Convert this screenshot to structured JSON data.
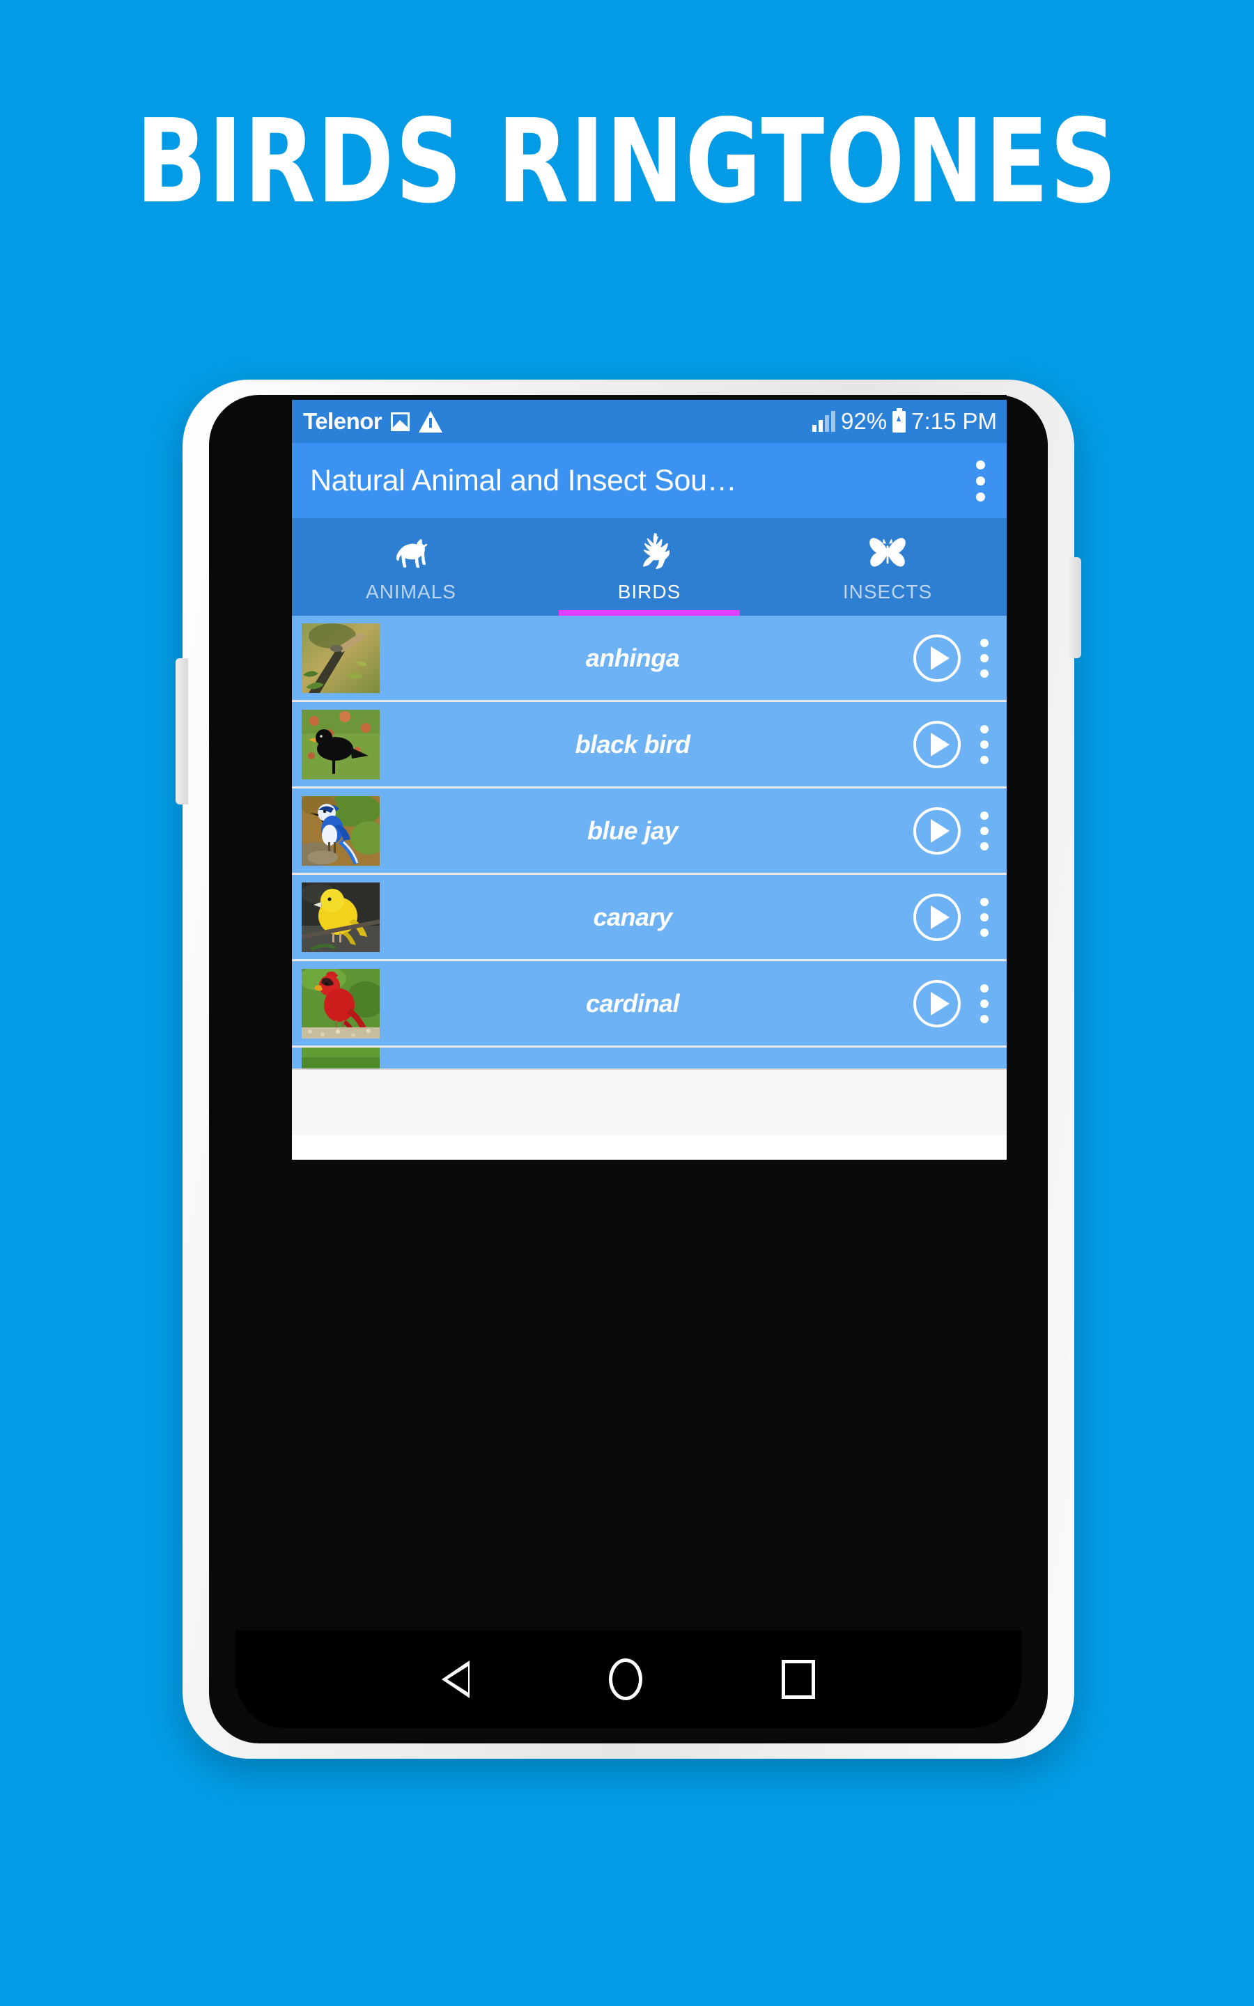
{
  "poster": {
    "title": "BIRDS RINGTONES",
    "background_color": "#039BE5"
  },
  "phone": {
    "case_color": "#F2F2F2",
    "body_color": "#090909"
  },
  "status_bar": {
    "carrier": "Telenor",
    "icons": [
      "image-icon",
      "warning-icon"
    ],
    "signal_icon": "signal-bars-icon",
    "battery_percent": "92%",
    "battery_icon": "battery-charging-icon",
    "time": "7:15 PM",
    "background_color": "#2B80D8"
  },
  "app_bar": {
    "title": "Natural Animal and Insect Sou…",
    "overflow_icon": "overflow-menu-icon",
    "background_color": "#3B92F1"
  },
  "tabs": {
    "indicator_color": "#E040FB",
    "background_color": "#2E7ED2",
    "active_index": 1,
    "items": [
      {
        "label": "ANIMALS",
        "icon": "dog-icon"
      },
      {
        "label": "BIRDS",
        "icon": "bird-icon"
      },
      {
        "label": "INSECTS",
        "icon": "butterfly-icon"
      }
    ]
  },
  "list": {
    "background_color": "#6DB2F5",
    "play_icon": "play-icon",
    "overflow_icon": "overflow-menu-icon",
    "rows": [
      {
        "label": "anhinga",
        "thumb": "anhinga-thumbnail"
      },
      {
        "label": "black bird",
        "thumb": "black-bird-thumbnail"
      },
      {
        "label": "blue jay",
        "thumb": "blue-jay-thumbnail"
      },
      {
        "label": "canary",
        "thumb": "canary-thumbnail"
      },
      {
        "label": "cardinal",
        "thumb": "cardinal-thumbnail"
      }
    ]
  },
  "ad_banner": {
    "background_color": "#F7F7F7"
  },
  "nav_bar": {
    "background_color": "#000000",
    "buttons": [
      {
        "icon": "back-icon"
      },
      {
        "icon": "home-icon"
      },
      {
        "icon": "recents-icon"
      }
    ]
  }
}
